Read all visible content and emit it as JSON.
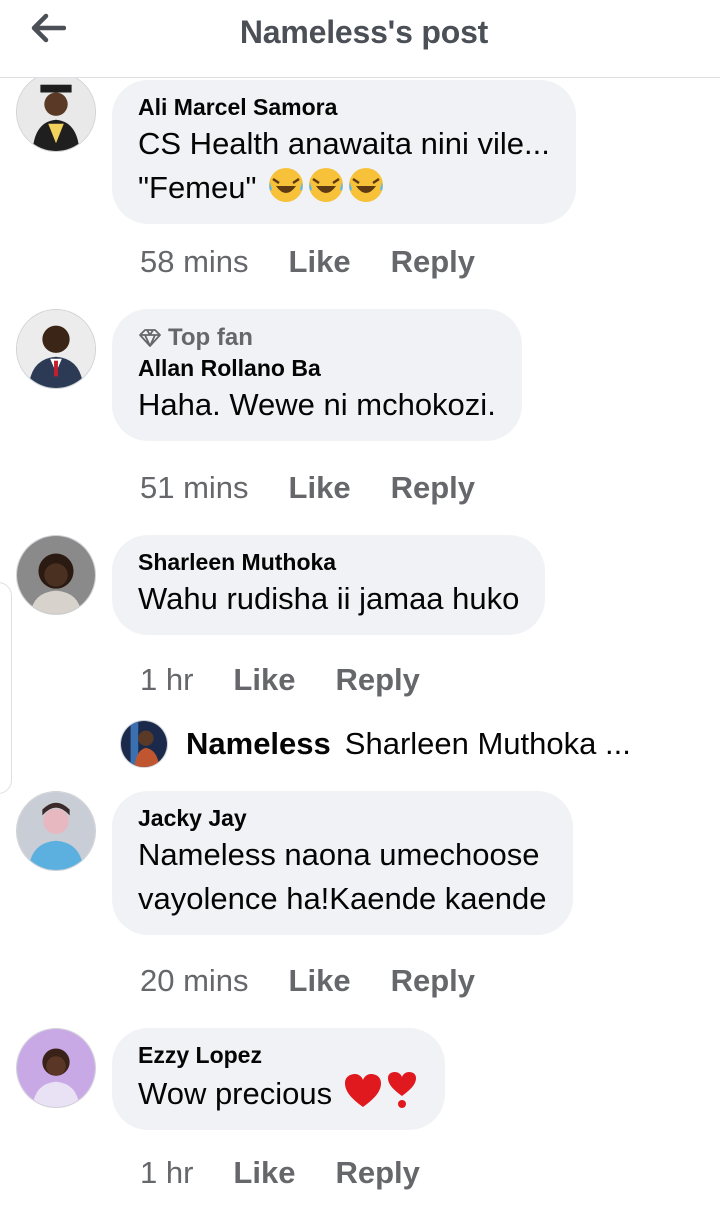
{
  "header": {
    "title": "Nameless's post",
    "back_icon": "arrow-left-icon"
  },
  "comments": [
    {
      "author": "Ali Marcel Samora",
      "top_fan": "",
      "lines": [
        "CS Health anawaita nini vile...",
        "\"Femeu\""
      ],
      "emojis": [
        "face-with-tears-of-joy",
        "face-with-tears-of-joy",
        "face-with-tears-of-joy"
      ],
      "time": "58 mins",
      "like": "Like",
      "reply": "Reply"
    },
    {
      "author": "Allan Rollano Ba",
      "top_fan": "Top fan",
      "lines": [
        "Haha. Wewe ni mchokozi."
      ],
      "time": "51 mins",
      "like": "Like",
      "reply": "Reply"
    },
    {
      "author": "Sharleen Muthoka",
      "top_fan": "",
      "lines": [
        "Wahu rudisha ii jamaa huko"
      ],
      "time": "1 hr",
      "like": "Like",
      "reply": "Reply",
      "reply_preview": {
        "name": "Nameless",
        "text": "Sharleen Muthoka ..."
      }
    },
    {
      "author": "Jacky Jay",
      "top_fan": "",
      "lines": [
        "Nameless naona umechoose",
        "vayolence ha!Kaende kaende"
      ],
      "time": "20 mins",
      "like": "Like",
      "reply": "Reply"
    },
    {
      "author": "Ezzy Lopez",
      "top_fan": "",
      "lines": [
        "Wow precious"
      ],
      "emojis": [
        "red-heart",
        "heavy-exclamation-heart"
      ],
      "time": "1 hr",
      "like": "Like",
      "reply": "Reply"
    }
  ],
  "colors": {
    "bubble": "#f0f2f5",
    "meta": "#65676b",
    "text": "#050505",
    "header_text": "#4b4f56"
  }
}
